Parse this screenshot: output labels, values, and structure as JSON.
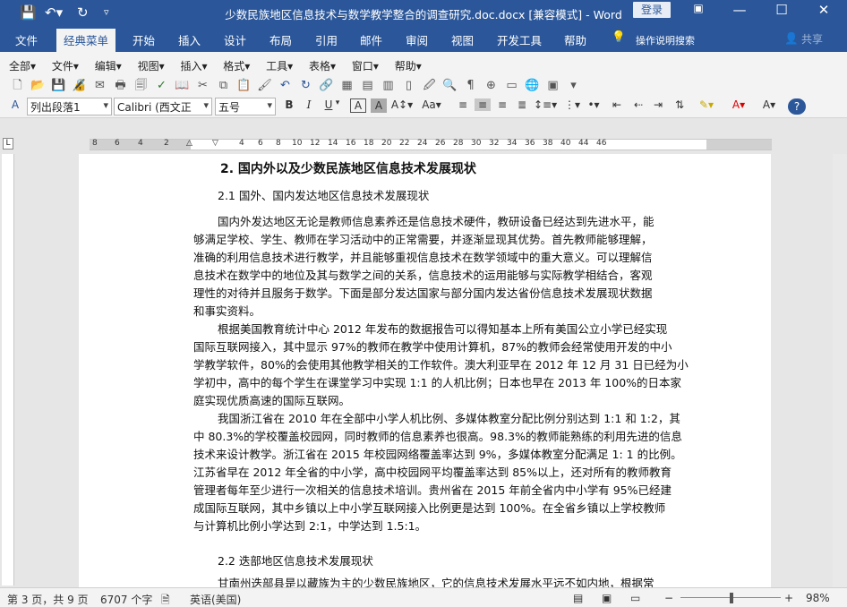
{
  "titlebar": {
    "title": "少数民族地区信息技术与数学教学整合的调查研究.doc.docx [兼容模式] - Word",
    "login": "登录"
  },
  "tabs": [
    "文件",
    "经典菜单",
    "开始",
    "插入",
    "设计",
    "布局",
    "引用",
    "邮件",
    "审阅",
    "视图",
    "开发工具",
    "帮助"
  ],
  "tell_me": "操作说明搜索",
  "share": "共享",
  "menu": [
    "全部▾",
    "文件▾",
    "编辑▾",
    "视图▾",
    "插入▾",
    "格式▾",
    "工具▾",
    "表格▾",
    "窗口▾",
    "帮助▾"
  ],
  "format": {
    "style": "列出段落1",
    "font": "Calibri (西文正",
    "size": "五号"
  },
  "ruler_numbers": [
    "8",
    "6",
    "4",
    "2",
    "2",
    "4",
    "6",
    "8",
    "10",
    "12",
    "14",
    "16",
    "18",
    "20",
    "22",
    "24",
    "26",
    "28",
    "30",
    "32",
    "34",
    "36",
    "38",
    "40",
    "44",
    "46"
  ],
  "document": {
    "heading": "2. 国内外以及少数民族地区信息技术发展现状",
    "sub1": "2.1 国外、国内发达地区信息技术发展现状",
    "lines": [
      "国内外发达地区无论是教师信息素养还是信息技术硬件，教研设备已经达到先进水平，能",
      "够满足学校、学生、教师在学习活动中的正常需要，并逐渐显现其优势。首先教师能够理解，",
      "准确的利用信息技术进行教学，并且能够重视信息技术在数学领域中的重大意义。可以理解信",
      "息技术在数学中的地位及其与数学之间的关系，信息技术的运用能够与实际教学相结合，客观",
      "理性的对待并且服务于数学。下面是部分发达国家与部分国内发达省份信息技术发展现状数据",
      "和事实资料。",
      "根据美国教育统计中心 2012 年发布的数据报告可以得知基本上所有美国公立小学已经实现",
      "国际互联网接入，其中显示 97%的教师在教学中使用计算机，87%的教师会经常使用开发的中小",
      "学教学软件，80%的会使用其他教学相关的工作软件。澳大利亚早在 2012 年 12 月 31 日已经为小",
      "学初中，高中的每个学生在课堂学习中实现 1:1 的人机比例；日本也早在 2013 年 100%的日本家",
      "庭实现优质高速的国际互联网。",
      "我国浙江省在 2010 年在全部中小学人机比例、多媒体教室分配比例分别达到 1:1 和 1:2，其",
      "中 80.3%的学校覆盖校园网，同时教师的信息素养也很高。98.3%的教师能熟练的利用先进的信息",
      "技术来设计教学。浙江省在 2015 年校园网络覆盖率达到 9%，多媒体教室分配满足 1: 1 的比例。",
      "江苏省早在 2012 年全省的中小学，高中校园网平均覆盖率达到 85%以上，还对所有的教师教育",
      "管理者每年至少进行一次相关的信息技术培训。贵州省在 2015 年前全省内中小学有 95%已经建",
      "成国际互联网，其中乡镇以上中小学互联网接入比例更是达到  100%。在全省乡镇以上学校教师",
      "与计算机比例小学达到 2:1，中学达到 1.5:1。"
    ],
    "sub2": "2.2 迭部地区信息技术发展现状",
    "last_line": "甘南州迭部县是以藏族为主的少数民族地区，它的信息技术发展水平远不如内地，根据常"
  },
  "status": {
    "page": "第 3 页，共 9 页",
    "words": "6707 个字",
    "lang": "英语(美国)",
    "zoom": "98%"
  },
  "colors": {
    "brand": "#2b579a"
  }
}
